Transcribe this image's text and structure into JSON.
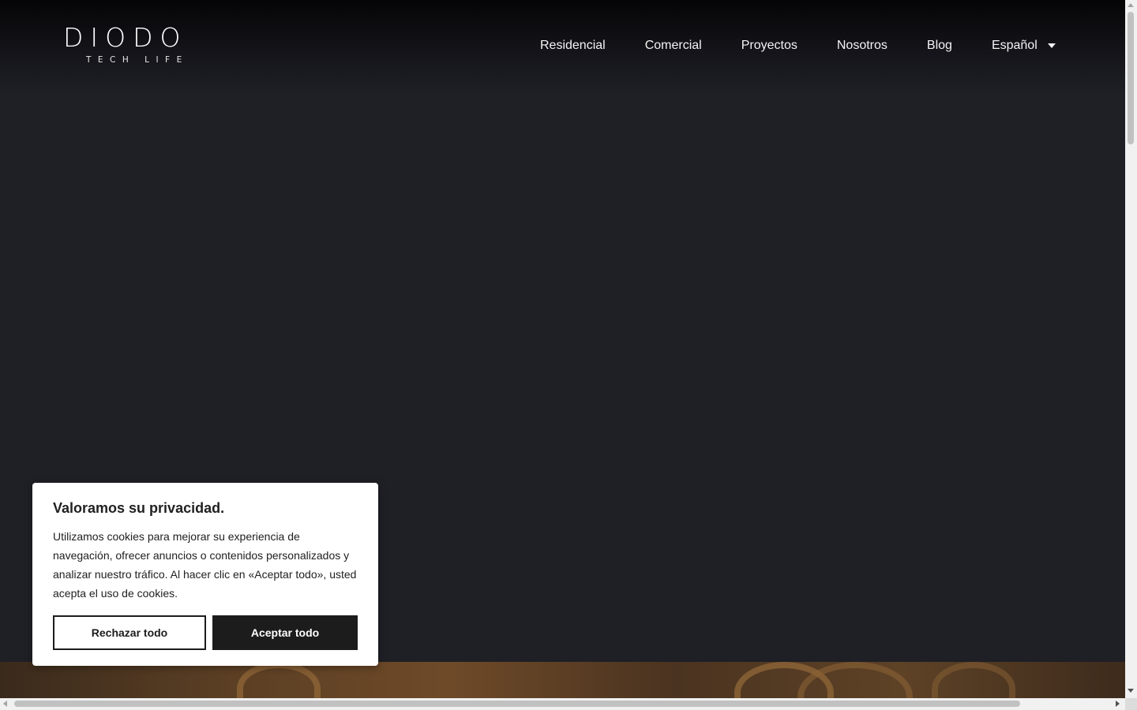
{
  "header": {
    "logo": {
      "main": "DIODO",
      "sub": "TECH LIFE"
    },
    "nav": {
      "items": [
        {
          "label": "Residencial"
        },
        {
          "label": "Comercial"
        },
        {
          "label": "Proyectos"
        },
        {
          "label": "Nosotros"
        },
        {
          "label": "Blog"
        }
      ],
      "language": {
        "label": "Español",
        "icon": "caret-down-icon"
      }
    }
  },
  "cookie_banner": {
    "title": "Valoramos su privacidad.",
    "text": "Utilizamos cookies para mejorar su experiencia de navegación, ofrecer anuncios o contenidos personalizados y analizar nuestro tráfico. Al hacer clic en «Aceptar todo», usted acepta el uso de cookies.",
    "reject_label": "Rechazar todo",
    "accept_label": "Aceptar todo"
  },
  "colors": {
    "background": "#1f1f26",
    "header_top": "#050506",
    "text_light": "#f4f4f4",
    "button_dark": "#1c1c1c"
  }
}
